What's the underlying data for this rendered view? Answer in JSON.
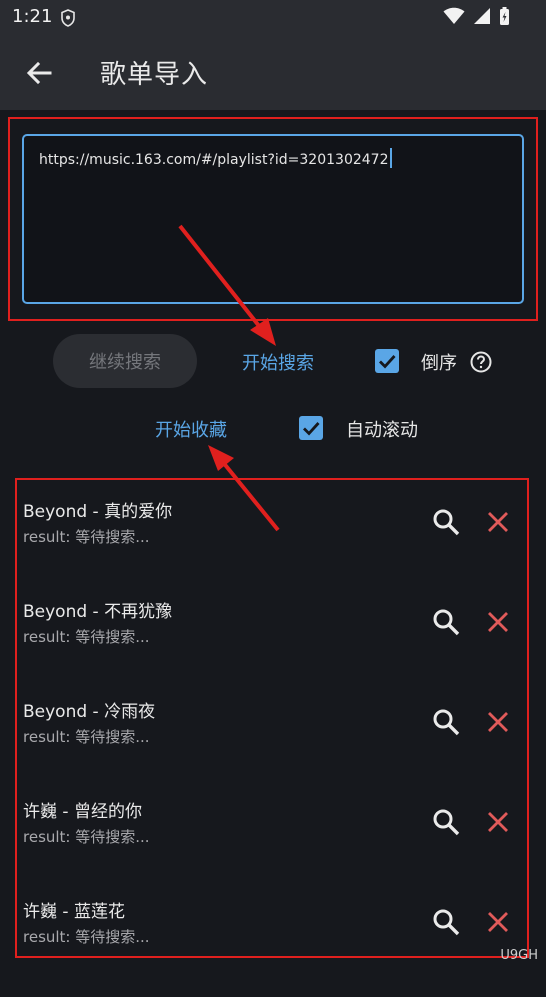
{
  "status_bar": {
    "time": "1:21"
  },
  "app_bar": {
    "title": "歌单导入"
  },
  "url_input": {
    "value": "https://music.163.com/#/playlist?id=3201302472"
  },
  "controls": {
    "continue_search": "继续搜索",
    "start_search": "开始搜索",
    "reverse_label": "倒序",
    "reverse_checked": true,
    "start_collect": "开始收藏",
    "auto_scroll_label": "自动滚动",
    "auto_scroll_checked": true
  },
  "songs": [
    {
      "title": "Beyond - 真的爱你",
      "result": "result: 等待搜索..."
    },
    {
      "title": "Beyond - 不再犹豫",
      "result": "result: 等待搜索..."
    },
    {
      "title": "Beyond - 冷雨夜",
      "result": "result: 等待搜索..."
    },
    {
      "title": "许巍 - 曾经的你",
      "result": "result: 等待搜索..."
    },
    {
      "title": "许巍 - 蓝莲花",
      "result": "result: 等待搜索..."
    }
  ],
  "watermark": "U9GH",
  "colors": {
    "accent": "#5aa6e6",
    "delete": "#e05a5a",
    "annotation": "#e0201e",
    "background": "#16181d",
    "appbar": "#2a2c31"
  }
}
